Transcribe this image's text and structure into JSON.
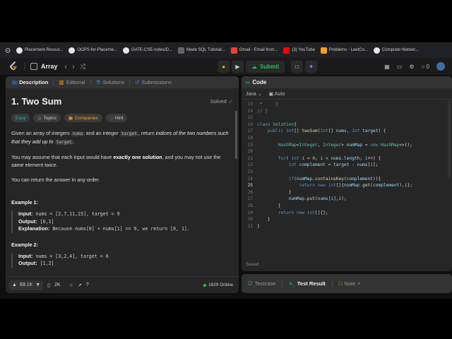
{
  "bookmarks": [
    {
      "label": "Placement-Resour...",
      "color": "#e6e6e6"
    },
    {
      "label": "OOPS-for-Placeme...",
      "color": "#e6e6e6"
    },
    {
      "label": "GATE-CSE-notes/D...",
      "color": "#e6e6e6"
    },
    {
      "label": "Mode SQL Tutorial...",
      "color": "#888888"
    },
    {
      "label": "Gmail - Email from...",
      "color": "#ea4335"
    },
    {
      "label": "(3) YouTube",
      "color": "#ff0000"
    },
    {
      "label": "Problems - LeetCo...",
      "color": "#ffa116"
    },
    {
      "label": "Computer-Networ...",
      "color": "#e6e6e6"
    }
  ],
  "nav": {
    "problem_list": "Array",
    "submit_label": "Submit",
    "streak": "0"
  },
  "left_tabs": {
    "description": "Description",
    "editorial": "Editorial",
    "solutions": "Solutions",
    "submissions": "Submissions"
  },
  "problem": {
    "title": "1. Two Sum",
    "status": "Solved",
    "difficulty": "Easy",
    "topics": "Topics",
    "companies": "Companies",
    "hint": "Hint",
    "p1_a": "Given an array of integers ",
    "p1_code1": "nums",
    "p1_b": " and an integer ",
    "p1_code2": "target",
    "p1_c": ", return ",
    "p1_i": "indices of the two numbers such that they add up to ",
    "p1_code3": "target",
    "p1_d": ".",
    "p2_a": "You may assume that each input would have ",
    "p2_b": "exactly one solution",
    "p2_c": ", and you may not use the ",
    "p2_i": "same",
    "p2_d": " element twice.",
    "p3": "You can return the answer in any order.",
    "examples": [
      {
        "title": "Example 1:",
        "input_label": "Input:",
        "input": " nums = [2,7,11,15], target = 9",
        "output_label": "Output:",
        "output": " [0,1]",
        "expl_label": "Explanation:",
        "expl": " Because nums[0] + nums[1] == 9, we return [0, 1]."
      },
      {
        "title": "Example 2:",
        "input_label": "Input:",
        "input": " nums = [3,2,4], target = 6",
        "output_label": "Output:",
        "output": " [1,2]"
      }
    ]
  },
  "left_footer": {
    "likes": "69.1K",
    "comments": "2K",
    "online": "1829 Online"
  },
  "code_panel": {
    "title": "Code",
    "language": "Java",
    "mode": "Auto",
    "saved": "Saved"
  },
  "console_tabs": {
    "testcase": "Testcase",
    "result": "Test Result",
    "note": "Note"
  }
}
